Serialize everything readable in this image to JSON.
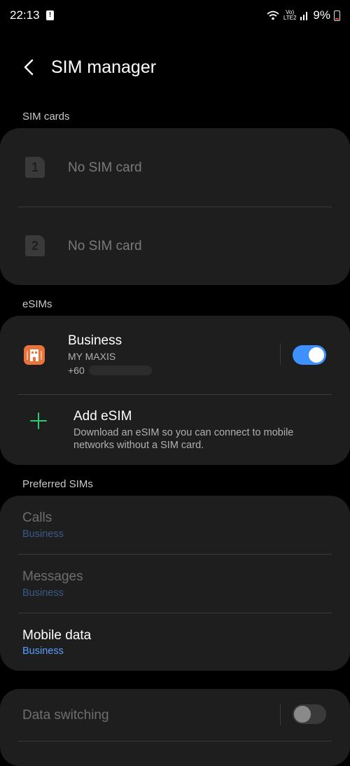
{
  "status_bar": {
    "time": "22:13",
    "battery": "9%",
    "network_label": "VoLTE2"
  },
  "header": {
    "title": "SIM manager"
  },
  "sim_cards": {
    "label": "SIM cards",
    "slots": [
      {
        "number": "1",
        "text": "No SIM card"
      },
      {
        "number": "2",
        "text": "No SIM card"
      }
    ]
  },
  "esims": {
    "label": "eSIMs",
    "profile": {
      "name": "Business",
      "operator": "MY MAXIS",
      "number_prefix": "+60",
      "enabled": true
    },
    "add": {
      "title": "Add eSIM",
      "description": "Download an eSIM so you can connect to mobile networks without a SIM card."
    }
  },
  "preferred_sims": {
    "label": "Preferred SIMs",
    "items": [
      {
        "title": "Calls",
        "value": "Business",
        "enabled": false
      },
      {
        "title": "Messages",
        "value": "Business",
        "enabled": false
      },
      {
        "title": "Mobile data",
        "value": "Business",
        "enabled": true
      }
    ]
  },
  "data_switching": {
    "title": "Data switching",
    "enabled": false
  },
  "colors": {
    "accent": "#3e91ff",
    "esim_icon": "#e8743b",
    "add_plus": "#2ecc71",
    "card_bg": "#1e1e1e"
  }
}
